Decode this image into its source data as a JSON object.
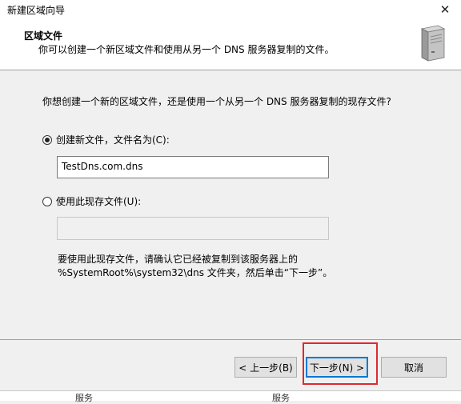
{
  "window": {
    "title": "新建区域向导"
  },
  "header": {
    "title": "区域文件",
    "subtitle": "你可以创建一个新区域文件和使用从另一个 DNS 服务器复制的文件。"
  },
  "body": {
    "question": "你想创建一个新的区域文件，还是使用一个从另一个 DNS 服务器复制的现存文件?",
    "option_new": {
      "label": "创建新文件，文件名为(C):",
      "selected": true
    },
    "new_file_value": "TestDns.com.dns",
    "option_existing": {
      "label": "使用此现存文件(U):",
      "selected": false
    },
    "existing_file_value": "",
    "note_line1": "要使用此现存文件，请确认它已经被复制到该服务器上的",
    "note_line2": "%SystemRoot%\\system32\\dns 文件夹，然后单击“下一步”。"
  },
  "buttons": {
    "back": "< 上一步(B)",
    "next": "下一步(N) >",
    "cancel": "取消"
  },
  "background": {
    "col1": "服务",
    "col2": "服务"
  },
  "colors": {
    "highlight_box": "#e0282f",
    "default_button_border": "#0078d7"
  }
}
